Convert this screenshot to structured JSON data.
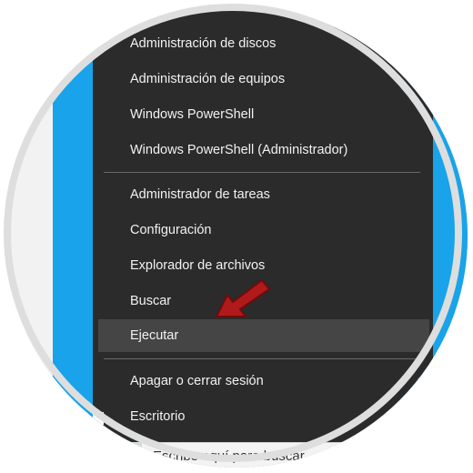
{
  "menu": {
    "items": [
      {
        "label": "Administración de discos"
      },
      {
        "label": "Administración de equipos"
      },
      {
        "label": "Windows PowerShell"
      },
      {
        "label": "Windows PowerShell (Administrador)"
      },
      {
        "label": "Administrador de tareas"
      },
      {
        "label": "Configuración"
      },
      {
        "label": "Explorador de archivos"
      },
      {
        "label": "Buscar"
      },
      {
        "label": "Ejecutar"
      },
      {
        "label": "Apagar o cerrar sesión"
      },
      {
        "label": "Escritorio"
      }
    ],
    "submenu_chevron": "›"
  },
  "taskbar": {
    "search_placeholder": "Escribe aquí para buscar"
  },
  "colors": {
    "menu_bg": "#2b2b2b",
    "highlight_bg": "#454545",
    "desktop_blue": "#18a3ea",
    "arrow_red": "#b01a1a"
  },
  "icons": [
    "red-arrow-pointer-icon",
    "chevron-right-icon"
  ]
}
